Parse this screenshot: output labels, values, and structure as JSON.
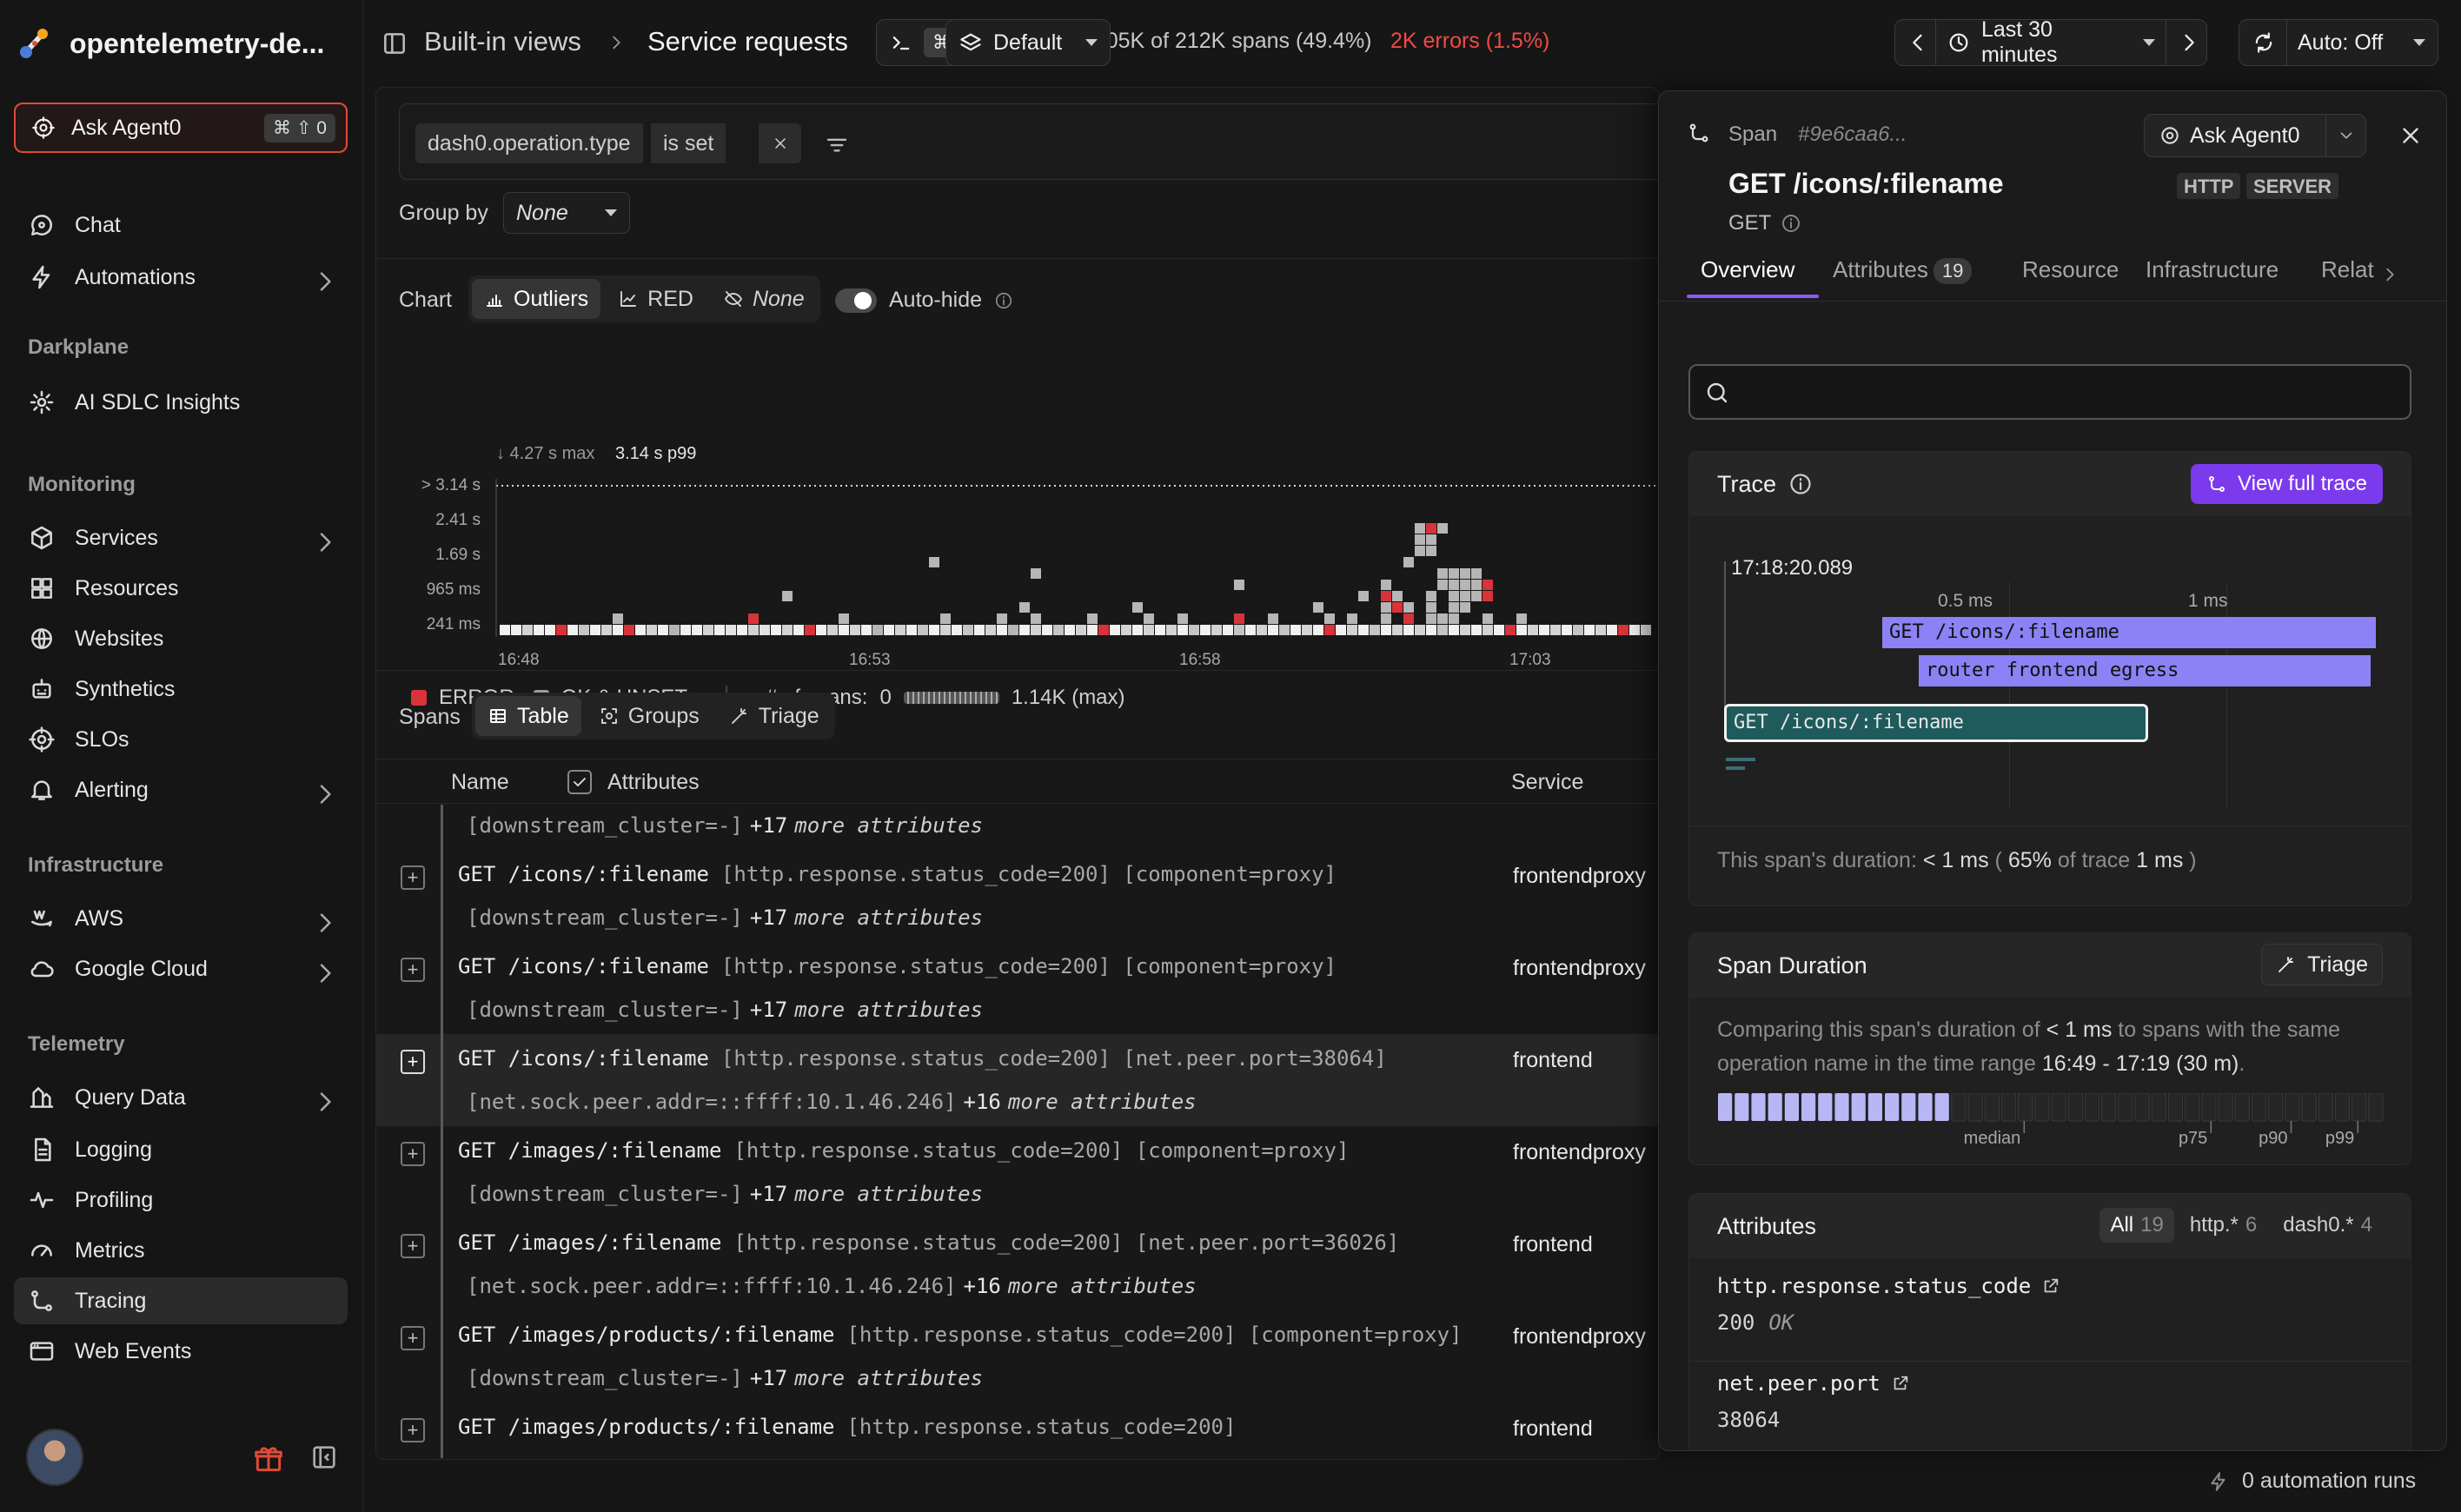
{
  "org": {
    "name": "opentelemetry-de..."
  },
  "agent": {
    "label": "Ask Agent0",
    "shortcut": "⌘ ⇧ 0"
  },
  "sidebar": {
    "top_items": [
      {
        "label": "Chat",
        "icon": "chat-icon"
      },
      {
        "label": "Automations",
        "icon": "bolt-icon",
        "chevron": true
      }
    ],
    "sections": [
      {
        "title": "Darkplane",
        "items": [
          {
            "label": "AI SDLC Insights",
            "icon": "insights-icon"
          }
        ]
      },
      {
        "title": "Monitoring",
        "items": [
          {
            "label": "Services",
            "icon": "cube-icon",
            "chevron": true
          },
          {
            "label": "Resources",
            "icon": "grid-icon"
          },
          {
            "label": "Websites",
            "icon": "globe-icon"
          },
          {
            "label": "Synthetics",
            "icon": "robot-icon"
          },
          {
            "label": "SLOs",
            "icon": "target-icon"
          },
          {
            "label": "Alerting",
            "icon": "bell-icon",
            "chevron": true
          }
        ]
      },
      {
        "title": "Infrastructure",
        "items": [
          {
            "label": "AWS",
            "icon": "aws-icon",
            "chevron": true
          },
          {
            "label": "Google Cloud",
            "icon": "cloud-icon",
            "chevron": true
          }
        ]
      },
      {
        "title": "Telemetry",
        "items": [
          {
            "label": "Query Data",
            "icon": "query-icon",
            "chevron": true
          },
          {
            "label": "Logging",
            "icon": "log-icon"
          },
          {
            "label": "Profiling",
            "icon": "pulse-icon"
          },
          {
            "label": "Metrics",
            "icon": "gauge-icon"
          },
          {
            "label": "Tracing",
            "icon": "trace-icon",
            "active": true
          },
          {
            "label": "Web Events",
            "icon": "browser-icon"
          }
        ]
      }
    ]
  },
  "topbar": {
    "breadcrumb_1": "Built-in views",
    "breadcrumb_2": "Service requests",
    "showing": "Showing 105K of 212K spans (49.4%)",
    "errors": "2K errors (1.5%)",
    "cmd_kbd": "⌘K",
    "view": "Default",
    "time_range": "Last 30 minutes",
    "refresh": "Auto: Off"
  },
  "filter": {
    "key": "dash0.operation.type",
    "op": "is set"
  },
  "groupby": {
    "label": "Group by",
    "value": "None"
  },
  "chart_controls": {
    "label": "Chart",
    "modes": [
      "Outliers",
      "RED",
      "None"
    ],
    "autohide": "Auto-hide"
  },
  "chart_data": {
    "type": "heatmap",
    "title": "",
    "max_label": "4.27 s max",
    "p99_label": "3.14 s p99",
    "y_ticks": [
      "> 3.14 s",
      "2.41 s",
      "1.69 s",
      "965 ms",
      "241 ms"
    ],
    "x_ticks": [
      "16:48",
      "16:53",
      "16:58",
      "17:03"
    ],
    "legend": {
      "error": "ERROR",
      "ok": "OK & UNSET",
      "count_label": "# of spans:",
      "count_min": "0",
      "count_max": "1.14K (max)"
    },
    "colors": {
      "error": "#d8333a",
      "ok": "#9a9a9a"
    },
    "cells": [
      [
        0,
        0,
        1,
        0
      ],
      [
        1,
        0,
        1,
        0
      ],
      [
        2,
        0,
        0.8,
        0
      ],
      [
        3,
        0,
        1,
        0
      ],
      [
        4,
        0,
        1,
        0
      ],
      [
        5,
        0,
        0.8,
        1
      ],
      [
        6,
        0,
        1,
        0
      ],
      [
        7,
        0,
        0.7,
        0
      ],
      [
        8,
        0,
        1,
        0
      ],
      [
        9,
        0,
        0.8,
        0
      ],
      [
        10,
        0,
        1,
        0
      ],
      [
        11,
        0,
        0.6,
        1
      ],
      [
        12,
        0,
        1,
        0
      ],
      [
        13,
        0,
        0.8,
        0
      ],
      [
        14,
        0,
        1,
        0
      ],
      [
        15,
        0,
        0.6,
        0
      ],
      [
        16,
        0,
        1,
        0
      ],
      [
        17,
        0,
        1,
        0
      ],
      [
        18,
        0,
        0.8,
        0
      ],
      [
        19,
        0,
        1,
        0
      ],
      [
        20,
        0,
        0.9,
        0
      ],
      [
        21,
        0,
        1,
        0
      ],
      [
        22,
        0,
        0.8,
        0
      ],
      [
        23,
        0,
        0.9,
        0
      ],
      [
        24,
        0,
        1,
        0
      ],
      [
        25,
        0,
        0.8,
        0
      ],
      [
        26,
        0,
        1,
        0
      ],
      [
        27,
        0,
        0.6,
        1
      ],
      [
        28,
        0,
        1,
        0
      ],
      [
        29,
        0,
        0.8,
        0
      ],
      [
        30,
        0,
        1,
        0
      ],
      [
        31,
        0,
        0.8,
        0
      ],
      [
        32,
        0,
        1,
        0
      ],
      [
        33,
        0,
        0.6,
        0
      ],
      [
        34,
        0,
        1,
        0
      ],
      [
        35,
        0,
        0.8,
        0
      ],
      [
        36,
        0,
        1,
        0
      ],
      [
        37,
        0,
        0.7,
        0
      ],
      [
        38,
        0,
        1,
        0
      ],
      [
        39,
        0,
        0.8,
        0
      ],
      [
        40,
        0,
        1,
        0
      ],
      [
        41,
        0,
        0.7,
        0
      ],
      [
        42,
        0,
        1,
        0
      ],
      [
        43,
        0,
        0.8,
        0
      ],
      [
        44,
        0,
        1,
        0
      ],
      [
        45,
        0,
        0.6,
        0
      ],
      [
        46,
        0,
        1,
        0
      ],
      [
        47,
        0,
        0.8,
        0
      ],
      [
        48,
        0,
        1,
        0
      ],
      [
        49,
        0,
        0.7,
        0
      ],
      [
        50,
        0,
        1,
        0
      ],
      [
        51,
        0,
        0.8,
        0
      ],
      [
        52,
        0,
        1,
        0
      ],
      [
        53,
        0,
        0.8,
        1
      ],
      [
        54,
        0,
        1,
        0
      ],
      [
        55,
        0,
        0.8,
        0
      ],
      [
        56,
        0,
        1,
        0
      ],
      [
        57,
        0,
        0.8,
        0
      ],
      [
        58,
        0,
        1,
        0
      ],
      [
        59,
        0,
        0.8,
        0
      ],
      [
        60,
        0,
        1,
        0
      ],
      [
        61,
        0,
        0.7,
        0
      ],
      [
        62,
        0,
        1,
        0
      ],
      [
        63,
        0,
        0.8,
        0
      ],
      [
        64,
        0,
        1,
        0
      ],
      [
        65,
        0,
        0.7,
        0
      ],
      [
        66,
        0,
        1,
        0
      ],
      [
        67,
        0,
        0.8,
        0
      ],
      [
        68,
        0,
        1,
        0
      ],
      [
        69,
        0,
        0.7,
        0
      ],
      [
        70,
        0,
        1,
        0
      ],
      [
        71,
        0,
        0.8,
        0
      ],
      [
        72,
        0,
        1,
        0
      ],
      [
        73,
        0,
        0.7,
        1
      ],
      [
        74,
        0,
        1,
        0
      ],
      [
        75,
        0,
        0.8,
        0
      ],
      [
        76,
        0,
        1,
        0
      ],
      [
        77,
        0,
        0.7,
        0
      ],
      [
        78,
        0,
        1,
        0
      ],
      [
        79,
        0,
        0.8,
        0
      ],
      [
        80,
        0,
        1,
        0
      ],
      [
        81,
        0,
        0.8,
        0
      ],
      [
        82,
        0,
        1,
        0
      ],
      [
        83,
        0,
        0.7,
        0
      ],
      [
        84,
        0,
        1,
        0
      ],
      [
        85,
        0,
        0.8,
        0
      ],
      [
        86,
        0,
        1,
        0
      ],
      [
        87,
        0,
        0.8,
        0
      ],
      [
        88,
        0,
        1,
        0
      ],
      [
        89,
        0,
        0.7,
        1
      ],
      [
        90,
        0,
        1,
        0
      ],
      [
        91,
        0,
        0.8,
        0
      ],
      [
        92,
        0,
        1,
        0
      ],
      [
        93,
        0,
        0.8,
        0
      ],
      [
        94,
        0,
        1,
        0
      ],
      [
        95,
        0,
        0.7,
        0
      ],
      [
        96,
        0,
        1,
        0
      ],
      [
        97,
        0,
        0.8,
        0
      ],
      [
        98,
        0,
        1,
        0
      ],
      [
        99,
        0,
        0.8,
        1
      ],
      [
        100,
        0,
        1,
        0
      ],
      [
        101,
        0,
        0.8,
        0
      ],
      [
        102,
        0,
        1,
        0
      ],
      [
        103,
        0,
        0.7,
        0
      ],
      [
        10,
        1,
        0.6,
        0
      ],
      [
        22,
        1,
        0.6,
        1
      ],
      [
        30,
        1,
        0.6,
        0
      ],
      [
        39,
        1,
        0.6,
        0
      ],
      [
        44,
        1,
        0.6,
        0
      ],
      [
        47,
        1,
        0.6,
        0
      ],
      [
        52,
        1,
        0.6,
        0
      ],
      [
        57,
        1,
        0.6,
        0
      ],
      [
        60,
        1,
        0.6,
        0
      ],
      [
        65,
        1,
        0.6,
        1
      ],
      [
        68,
        1,
        0.6,
        0
      ],
      [
        73,
        1,
        0.6,
        0
      ],
      [
        75,
        1,
        0.6,
        0
      ],
      [
        78,
        1,
        0.6,
        0
      ],
      [
        80,
        1,
        0.6,
        1
      ],
      [
        82,
        1,
        0.6,
        0
      ],
      [
        83,
        1,
        0.6,
        0
      ],
      [
        84,
        1,
        0.6,
        0
      ],
      [
        87,
        1,
        0.6,
        0
      ],
      [
        90,
        1,
        0.6,
        0
      ],
      [
        46,
        2,
        0.6,
        0
      ],
      [
        56,
        2,
        0.6,
        0
      ],
      [
        72,
        2,
        0.6,
        0
      ],
      [
        78,
        2,
        0.6,
        0
      ],
      [
        79,
        2,
        0.6,
        1
      ],
      [
        80,
        2,
        0.6,
        0
      ],
      [
        82,
        2,
        0.6,
        0
      ],
      [
        84,
        2,
        0.6,
        0
      ],
      [
        85,
        2,
        0.6,
        0
      ],
      [
        25,
        3,
        0.6,
        0
      ],
      [
        76,
        3,
        0.6,
        0
      ],
      [
        78,
        3,
        0.6,
        1
      ],
      [
        79,
        3,
        0.6,
        0
      ],
      [
        82,
        3,
        0.6,
        0
      ],
      [
        84,
        3,
        0.6,
        0
      ],
      [
        85,
        3,
        0.6,
        0
      ],
      [
        86,
        3,
        0.6,
        0
      ],
      [
        87,
        3,
        0.6,
        1
      ],
      [
        65,
        4,
        0.6,
        0
      ],
      [
        78,
        4,
        0.6,
        0
      ],
      [
        83,
        4,
        0.6,
        0
      ],
      [
        84,
        4,
        0.6,
        0
      ],
      [
        85,
        4,
        0.6,
        0
      ],
      [
        86,
        4,
        0.6,
        0
      ],
      [
        87,
        4,
        0.6,
        1
      ],
      [
        47,
        5,
        0.6,
        0
      ],
      [
        83,
        5,
        0.6,
        0
      ],
      [
        84,
        5,
        0.6,
        0
      ],
      [
        85,
        5,
        0.6,
        0
      ],
      [
        86,
        5,
        0.6,
        0
      ],
      [
        38,
        6,
        0.6,
        0
      ],
      [
        80,
        6,
        0.6,
        0
      ],
      [
        81,
        7,
        0.6,
        0
      ],
      [
        82,
        7,
        0.6,
        0
      ],
      [
        81,
        8,
        0.6,
        0
      ],
      [
        82,
        8,
        0.6,
        0
      ],
      [
        81,
        9,
        0.6,
        0
      ],
      [
        82,
        9,
        0.6,
        1
      ],
      [
        83,
        9,
        0.6,
        0
      ]
    ]
  },
  "spans": {
    "label": "Spans",
    "tabs": [
      "Table",
      "Groups",
      "Triage"
    ],
    "columns": {
      "name": "Name",
      "attributes": "Attributes",
      "service": "Service"
    },
    "partial_row": {
      "l2": "[downstream_cluster=-]",
      "more_n": "+17",
      "more_t": "more attributes"
    },
    "rows": [
      {
        "name": "GET /icons/:filename",
        "attrs": "[http.response.status_code=200] [component=proxy]",
        "l2": "[downstream_cluster=-]",
        "more_n": "+17",
        "more_t": "more attributes",
        "service": "frontendproxy",
        "selected": false
      },
      {
        "name": "GET /icons/:filename",
        "attrs": "[http.response.status_code=200] [component=proxy]",
        "l2": "[downstream_cluster=-]",
        "more_n": "+17",
        "more_t": "more attributes",
        "service": "frontendproxy",
        "selected": false
      },
      {
        "name": "GET /icons/:filename",
        "attrs": "[http.response.status_code=200] [net.peer.port=38064]",
        "l2": "[net.sock.peer.addr=::ffff:10.1.46.246]",
        "more_n": "+16",
        "more_t": "more attributes",
        "service": "frontend",
        "selected": true
      },
      {
        "name": "GET /images/:filename",
        "attrs": "[http.response.status_code=200] [component=proxy]",
        "l2": "[downstream_cluster=-]",
        "more_n": "+17",
        "more_t": "more attributes",
        "service": "frontendproxy",
        "selected": false
      },
      {
        "name": "GET /images/:filename",
        "attrs": "[http.response.status_code=200] [net.peer.port=36026]",
        "l2": "[net.sock.peer.addr=::ffff:10.1.46.246]",
        "more_n": "+16",
        "more_t": "more attributes",
        "service": "frontend",
        "selected": false
      },
      {
        "name": "GET /images/products/:filename",
        "attrs": "[http.response.status_code=200] [component=proxy]",
        "l2": "[downstream_cluster=-]",
        "more_n": "+17",
        "more_t": "more attributes",
        "service": "frontendproxy",
        "selected": false
      },
      {
        "name": "GET /images/products/:filename",
        "attrs": "[http.response.status_code=200]",
        "l2": "",
        "more_n": "",
        "more_t": "",
        "service": "frontend",
        "selected": false
      }
    ]
  },
  "panel": {
    "kind": "Span",
    "span_id": "#9e6caa6...",
    "agent_label": "Ask Agent0",
    "title": "GET /icons/:filename",
    "badges": [
      "HTTP",
      "SERVER"
    ],
    "method": "GET",
    "tabs": [
      {
        "label": "Overview"
      },
      {
        "label": "Attributes",
        "count": "19"
      },
      {
        "label": "Resource"
      },
      {
        "label": "Infrastructure"
      },
      {
        "label": "Relat"
      }
    ],
    "trace": {
      "title": "Trace",
      "view_full": "View full trace",
      "start": "17:18:20.089",
      "tick_half": "0.5 ms",
      "tick_one": "1 ms",
      "bars": [
        "GET /icons/:filename",
        "router frontend egress",
        "GET /icons/:filename"
      ],
      "duration_prefix": "This span's duration:",
      "duration": "< 1 ms",
      "pct": "65%",
      "of_trace": "of trace",
      "trace_total": "1 ms"
    },
    "span_duration": {
      "title": "Span Duration",
      "triage": "Triage",
      "text_1": "Comparing this span's duration of",
      "value": "< 1 ms",
      "text_2": "to spans with the same operation name in the time range",
      "range": "16:49 - 17:19 (30 m)",
      "median": "median",
      "p75": "p75",
      "p90": "p90",
      "p99": "p99",
      "filled_fraction": 0.35
    },
    "attributes": {
      "title": "Attributes",
      "filters": [
        {
          "label": "All",
          "count": "19",
          "on": true
        },
        {
          "label": "http.*",
          "count": "6",
          "on": false
        },
        {
          "label": "dash0.*",
          "count": "4",
          "on": false
        }
      ],
      "items": [
        {
          "key": "http.response.status_code",
          "value": "200",
          "hint": "OK"
        },
        {
          "key": "net.peer.port",
          "value": "38064",
          "hint": ""
        }
      ]
    }
  },
  "footer": {
    "runs": "0 automation runs"
  }
}
